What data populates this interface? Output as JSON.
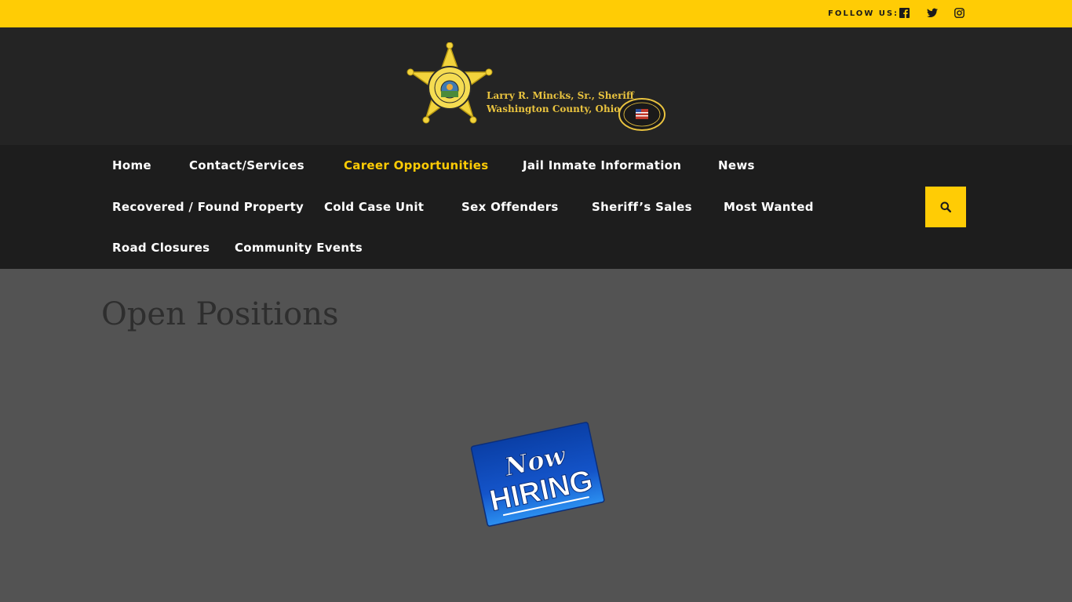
{
  "topbar": {
    "follow_label": "FOLLOW US:",
    "social": [
      {
        "icon": "facebook-icon"
      },
      {
        "icon": "twitter-icon"
      },
      {
        "icon": "instagram-icon"
      }
    ],
    "color": "#ffcc05"
  },
  "header": {
    "logo_line1": "Larry R. Mincks, Sr., Sheriff",
    "logo_line2": "Washington County, Ohio",
    "badge_text": "SHERIFF",
    "seal_top": "FIRST TO SERVE",
    "seal_bottom": "SINCE 1788"
  },
  "nav": {
    "items": [
      {
        "label": "Home"
      },
      {
        "label": "Contact/Services"
      },
      {
        "label": "Career Opportunities",
        "active": true
      },
      {
        "label": "Jail Inmate Information"
      },
      {
        "label": "News"
      },
      {
        "label": "Recovered / Found Property"
      },
      {
        "label": "Cold Case Unit"
      },
      {
        "label": "Sex Offenders"
      },
      {
        "label": "Sheriff’s Sales"
      },
      {
        "label": "Most Wanted"
      },
      {
        "label": "Road Closures"
      },
      {
        "label": "Community Events"
      }
    ],
    "search_icon": "search-icon"
  },
  "main": {
    "title": "Open Positions",
    "sign_line1": "Now",
    "sign_line2": "HIRING"
  }
}
